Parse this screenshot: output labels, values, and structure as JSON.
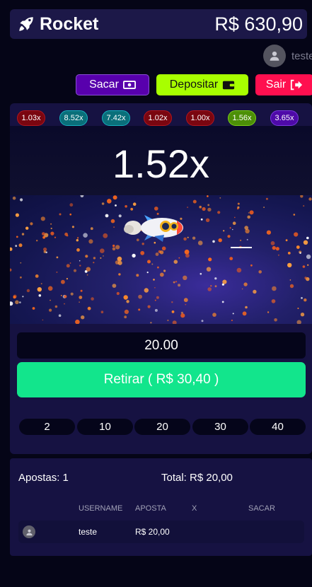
{
  "header": {
    "brand": "Rocket",
    "balance": "R$ 630,90"
  },
  "user": {
    "name": "teste"
  },
  "actions": {
    "sacar_label": "Sacar",
    "depositar_label": "Depositar",
    "sair_label": "Sair"
  },
  "history": [
    {
      "value": "1.03x",
      "color": "#7a0610"
    },
    {
      "value": "8.52x",
      "color": "#0a6f7a"
    },
    {
      "value": "7.42x",
      "color": "#0a6f7a"
    },
    {
      "value": "1.02x",
      "color": "#7a0610"
    },
    {
      "value": "1.00x",
      "color": "#7a0610"
    },
    {
      "value": "1.56x",
      "color": "#4c8f07"
    },
    {
      "value": "3.65x",
      "color": "#4e0aa8"
    }
  ],
  "game": {
    "multiplier": "1.52x",
    "bet_value": "20.00",
    "cashout_label": "Retirar ( R$ 30,40 )",
    "quick_amounts": [
      "2",
      "10",
      "20",
      "30",
      "40"
    ]
  },
  "bets": {
    "count_label": "Apostas: 1",
    "total_label": "Total: R$ 20,00",
    "columns": [
      "USERNAME",
      "APOSTA",
      "X",
      "SACAR"
    ],
    "rows": [
      {
        "username": "teste",
        "aposta": "R$ 20,00",
        "x": "",
        "sacar": ""
      }
    ]
  },
  "colors": {
    "accent_green": "#12e58c",
    "depositar": "#a8ff00",
    "sair": "#ff0f4f",
    "sacar": "#5800ad"
  }
}
